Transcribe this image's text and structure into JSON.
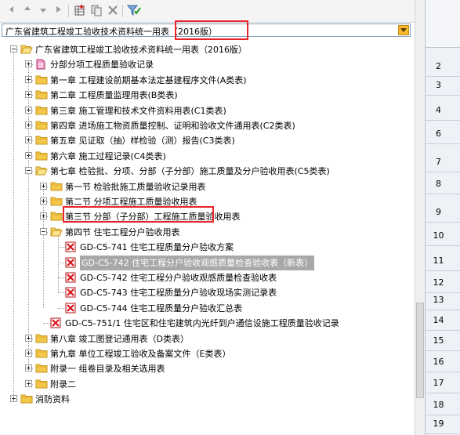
{
  "dropdown": {
    "value": "广东省建筑工程竣工验收技术资料统一用表（2016版）"
  },
  "toolbar": {
    "icons": [
      "arrow-left-icon",
      "arrow-right-icon",
      "arrow-down-icon",
      "arrow-end-icon",
      "add-table-icon",
      "copy-icon",
      "delete-icon",
      "filter-check-icon"
    ]
  },
  "tree": {
    "root": "广东省建筑工程竣工验收技术资料统一用表（2016版）",
    "items": [
      {
        "label": "分部分项工程质量验收记录"
      },
      {
        "label": "第一章  工程建设前期基本法定基建程序文件(A类表)"
      },
      {
        "label": "第二章  工程质量监理用表(B类表)"
      },
      {
        "label": "第三章  施工管理和技术文件资料用表(C1类表)"
      },
      {
        "label": "第四章  进场施工物资质量控制、证明和验收文件通用表(C2类表)"
      },
      {
        "label": "第五章   见证取（抽）样检验（测）报告(C3类表)"
      },
      {
        "label": "第六章  施工过程记录(C4类表)"
      },
      {
        "label": "第七章  检验批、分项、分部（子分部）施工质量及分户验收用表(C5类表)"
      },
      {
        "label": "第一节  检验批施工质量验收记录用表"
      },
      {
        "label": "第二节  分项工程施工质量验收用表"
      },
      {
        "label": "第三节  分部（子分部）工程施工质量验收用表"
      },
      {
        "label": "第四节  住宅工程分户验收用表"
      },
      {
        "label": "GD-C5-741  住宅工程质量分户验收方案"
      },
      {
        "label": "GD-C5-742  住宅工程分户验收观感质量检查验收表（新表）"
      },
      {
        "label": "GD-C5-742  住宅工程分户验收观感质量检查验收表"
      },
      {
        "label": "GD-C5-743  住宅工程质量分户验收现场实测记录表"
      },
      {
        "label": "GD-C5-744  住宅工程质量分户验收汇总表"
      },
      {
        "label": "GD-C5-751/1  住宅区和住宅建筑内光纤到户通信设施工程质量验收记录"
      },
      {
        "label": "第八章  竣工图登记通用表（D类表）"
      },
      {
        "label": "第九章  单位工程竣工验收及备案文件（E类表）"
      },
      {
        "label": "附录一  组卷目录及相关选用表"
      },
      {
        "label": "附录二"
      },
      {
        "label": "消防资料"
      }
    ]
  },
  "row_numbers": [
    "2",
    "3",
    "4",
    "6",
    "7",
    "8",
    "9",
    "10",
    "11",
    "12",
    "13",
    "14",
    "15",
    "16",
    "17",
    "18",
    "19"
  ],
  "colors": {
    "selection": "#a8a8a8",
    "highlight_box": "#e8232b",
    "folder": "#f3c84a",
    "doc_red": "#d9141b"
  }
}
